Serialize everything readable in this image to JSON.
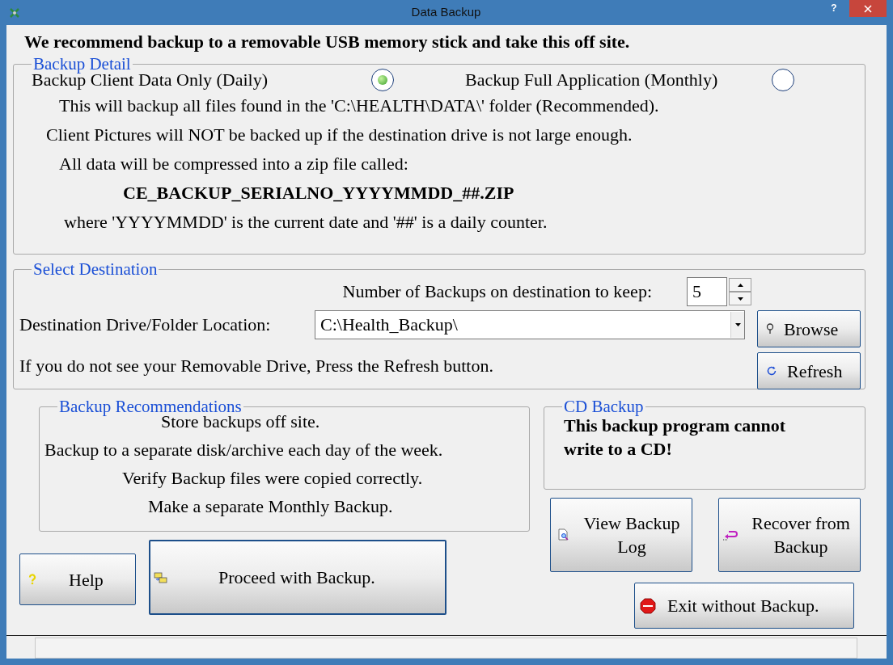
{
  "window": {
    "title": "Data Backup",
    "help": "?"
  },
  "heading": "We recommend backup to a removable USB memory stick and take this off site.",
  "backup_detail": {
    "legend": "Backup Detail",
    "options": [
      {
        "label": "Backup Client Data Only (Daily)",
        "selected": true
      },
      {
        "label": "Backup Full Application (Monthly)",
        "selected": false
      }
    ],
    "lines": [
      {
        "kind": "note",
        "text": "This will backup all files found in the 'C:\\HEALTH\\DATA\\' folder (Recommended)."
      },
      {
        "kind": "note",
        "text": "Client Pictures will NOT be backed up if the destination drive is not large enough."
      },
      {
        "kind": "note",
        "text": "All data will be compressed into a zip file called:"
      },
      {
        "kind": "filename",
        "text": "CE_BACKUP_SERIALNO_YYYYMMDD_##.ZIP"
      },
      {
        "kind": "note",
        "text": "where 'YYYYMMDD' is the current date and '##' is a daily counter."
      }
    ]
  },
  "destination": {
    "legend": "Select Destination",
    "keep_label": "Number of Backups on destination to keep:",
    "keep_value": "5",
    "location_label": "Destination Drive/Folder Location:",
    "location_value": "C:\\Health_Backup\\",
    "hint": "If you do not see your Removable Drive, Press the Refresh button.",
    "buttons": [
      {
        "kind": "browse",
        "label": "Browse"
      },
      {
        "kind": "refresh",
        "label": "Refresh"
      }
    ]
  },
  "recommendations": {
    "legend": "Backup Recommendations",
    "lines": [
      "Store backups off site.",
      "Backup to a separate disk/archive each day of the week.",
      "Verify Backup files were copied correctly.",
      "Make a separate Monthly Backup."
    ]
  },
  "cd_backup": {
    "legend": "CD Backup",
    "message": "This backup program cannot write to a CD!"
  },
  "buttons": {
    "help": "Help",
    "proceed": "Proceed with Backup.",
    "view_log": "View Backup Log",
    "recover": "Recover from Backup",
    "exit": "Exit without Backup."
  }
}
